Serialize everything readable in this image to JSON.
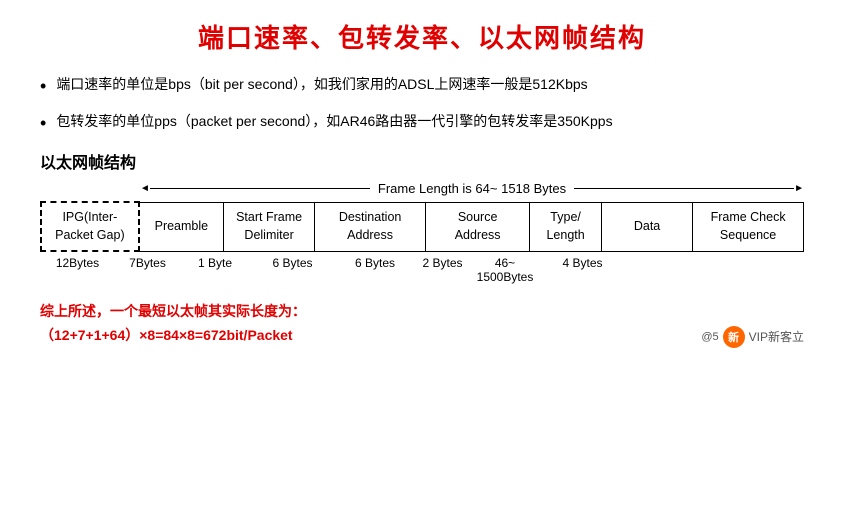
{
  "title": "端口速率、包转发率、以太网帧结构",
  "bullets": [
    {
      "text": "端口速率的单位是bps（bit per second），如我们家用的ADSL上网速率一般是512Kbps"
    },
    {
      "text": "包转发率的单位pps（packet per second），如AR46路由器一代引擎的包转发率是350Kpps"
    }
  ],
  "section_title": "以太网帧结构",
  "frame_length_label": "Frame Length  is 64~  1518 Bytes",
  "frame_columns": [
    {
      "label": "IPG(Inter-Packet Gap)",
      "bytes": "12Bytes",
      "dashed": true
    },
    {
      "label": "Preamble",
      "bytes": "7Bytes",
      "dashed": false
    },
    {
      "label": "Start Frame Delimiter",
      "bytes": "1 Byte",
      "dashed": false
    },
    {
      "label": "Destination Address",
      "bytes": "6 Bytes",
      "dashed": false
    },
    {
      "label": "Source Address",
      "bytes": "6 Bytes",
      "dashed": false
    },
    {
      "label": "Type/ Length",
      "bytes": "2 Bytes",
      "dashed": false
    },
    {
      "label": "Data",
      "bytes": "46~  1500Bytes",
      "dashed": false
    },
    {
      "label": "Frame Check Sequence",
      "bytes": "4 Bytes",
      "dashed": false
    }
  ],
  "summary": {
    "line1": "综上所述，一个最短以太帧其实际长度为：",
    "line2": "（12+7+1+64）×8=84×8=672bit/Packet"
  },
  "watermark": {
    "icon": "新",
    "text": "VIP新客立"
  }
}
